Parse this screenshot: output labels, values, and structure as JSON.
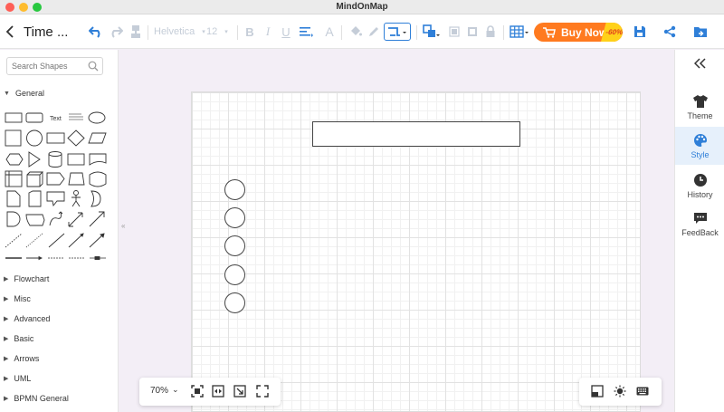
{
  "app": {
    "title": "MindOnMap"
  },
  "toolbar": {
    "document_title": "Time ...",
    "font_name": "Helvetica",
    "font_size": "12",
    "buy_now_label": "Buy Now",
    "discount_badge": "-60%",
    "accent_color": "#2f7fd8",
    "buy_color": "#ff7a1f"
  },
  "left_panel": {
    "search_placeholder": "Search Shapes",
    "categories": [
      {
        "label": "General",
        "expanded": true
      },
      {
        "label": "Flowchart",
        "expanded": false
      },
      {
        "label": "Misc",
        "expanded": false
      },
      {
        "label": "Advanced",
        "expanded": false
      },
      {
        "label": "Basic",
        "expanded": false
      },
      {
        "label": "Arrows",
        "expanded": false
      },
      {
        "label": "UML",
        "expanded": false
      },
      {
        "label": "BPMN General",
        "expanded": false
      }
    ],
    "general_shapes_text": {
      "text_shape": "Text"
    }
  },
  "canvas": {
    "shapes": [
      {
        "type": "rectangle"
      },
      {
        "type": "circle"
      },
      {
        "type": "circle"
      },
      {
        "type": "circle"
      },
      {
        "type": "circle"
      },
      {
        "type": "circle"
      }
    ]
  },
  "zoom": {
    "level": "70%"
  },
  "right_panel": {
    "items": [
      {
        "label": "Theme",
        "icon": "shirt-icon",
        "active": false
      },
      {
        "label": "Style",
        "icon": "palette-icon",
        "active": true
      },
      {
        "label": "History",
        "icon": "clock-icon",
        "active": false
      },
      {
        "label": "FeedBack",
        "icon": "feedback-icon",
        "active": false
      }
    ]
  }
}
